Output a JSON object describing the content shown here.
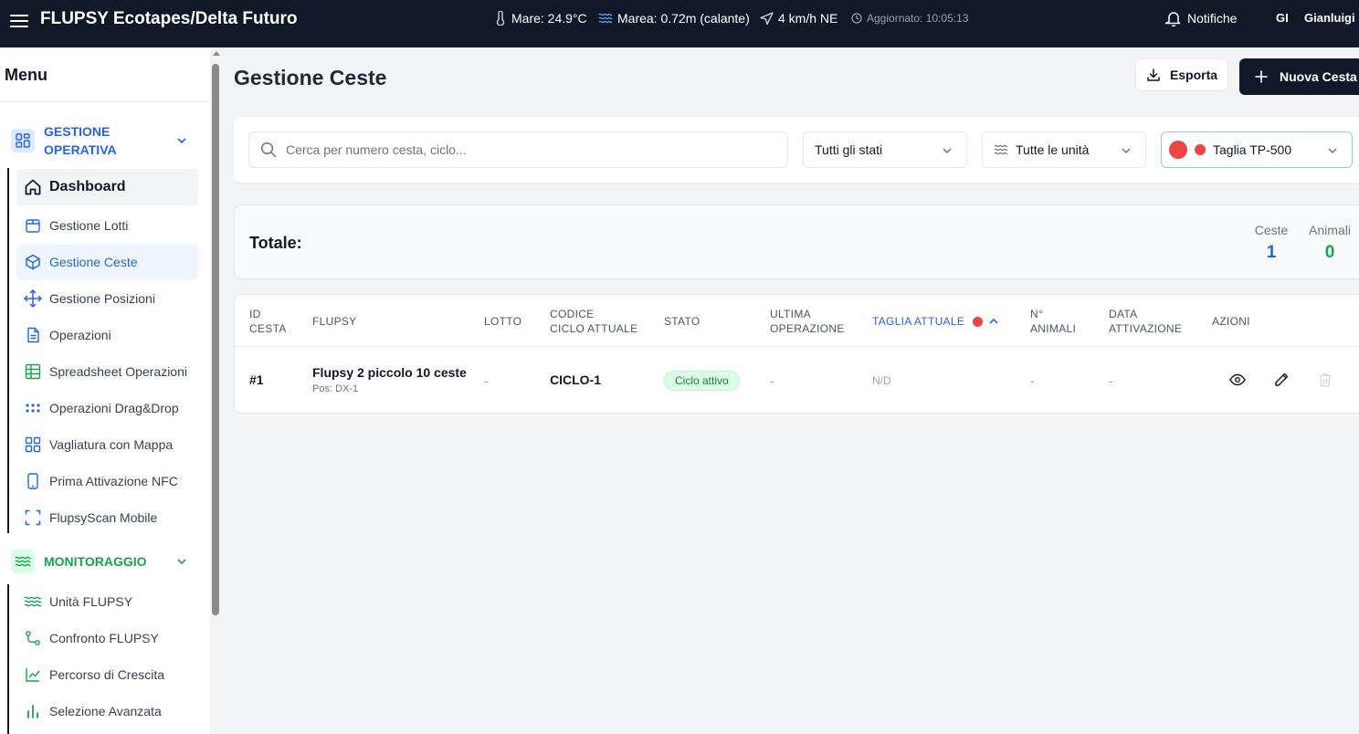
{
  "app": {
    "title": "FLUPSY Ecotapes/Delta Futuro"
  },
  "header": {
    "sea_temp": "Mare: 24.9°C",
    "tide": "Marea: 0.72m (calante)",
    "wind": "4 km/h NE",
    "updated": "Aggiornato: 10:05:13",
    "notifications_label": "Notifiche",
    "user_initials": "GI",
    "user_name": "Gianluigi"
  },
  "sidebar": {
    "title": "Menu",
    "sections": [
      {
        "label": "GESTIONE OPERATIVA",
        "icon": "grid-icon",
        "color": "#2563eb",
        "items": [
          {
            "label": "Dashboard",
            "icon": "home-icon"
          },
          {
            "label": "Gestione Lotti",
            "icon": "package-icon"
          },
          {
            "label": "Gestione Ceste",
            "icon": "box-icon",
            "active": true
          },
          {
            "label": "Gestione Posizioni",
            "icon": "move-icon"
          },
          {
            "label": "Operazioni",
            "icon": "file-icon"
          },
          {
            "label": "Spreadsheet Operazioni",
            "icon": "table-icon"
          },
          {
            "label": "Operazioni Drag&Drop",
            "icon": "grip-icon"
          },
          {
            "label": "Vagliatura con Mappa",
            "icon": "grid-icon"
          },
          {
            "label": "Prima Attivazione NFC",
            "icon": "smartphone-icon"
          },
          {
            "label": "FlupsyScan Mobile",
            "icon": "scan-icon"
          }
        ]
      },
      {
        "label": "MONITORAGGIO",
        "icon": "waves-icon",
        "color": "#16a34a",
        "items": [
          {
            "label": "Unità FLUPSY",
            "icon": "waves-icon"
          },
          {
            "label": "Confronto FLUPSY",
            "icon": "route-icon"
          },
          {
            "label": "Percorso di Crescita",
            "icon": "line-chart-icon"
          },
          {
            "label": "Selezione Avanzata",
            "icon": "bar-chart-icon"
          }
        ]
      }
    ]
  },
  "page": {
    "title": "Gestione Ceste",
    "export_label": "Esporta",
    "new_label": "Nuova Cesta"
  },
  "filters": {
    "search_placeholder": "Cerca per numero cesta, ciclo...",
    "search_value": "",
    "status": "Tutti gli stati",
    "unit": "Tutte le unità",
    "size": "Taglia TP-500",
    "size_color": "#ef4444"
  },
  "totals": {
    "label": "Totale:",
    "ceste_label": "Ceste",
    "ceste_value": "1",
    "animali_label": "Animali",
    "animali_value": "0"
  },
  "table": {
    "headers": {
      "id": [
        "ID",
        "CESTA"
      ],
      "flupsy": "FLUPSY",
      "lotto": "LOTTO",
      "codice": [
        "CODICE",
        "CICLO ATTUALE"
      ],
      "stato": "STATO",
      "ultima": [
        "ULTIMA",
        "OPERAZIONE"
      ],
      "taglia": "TAGLIA ATTUALE",
      "animali": [
        "N°",
        "ANIMALI"
      ],
      "data": [
        "DATA",
        "ATTIVAZIONE"
      ],
      "azioni": "AZIONI"
    },
    "rows": [
      {
        "id": "#1",
        "flupsy": "Flupsy 2 piccolo 10 ceste",
        "pos": "Pos: DX-1",
        "lotto": "-",
        "ciclo": "CICLO-1",
        "stato": "Ciclo attivo",
        "ultima": "-",
        "taglia": "N/D",
        "animali": "-",
        "data": "-"
      }
    ]
  }
}
